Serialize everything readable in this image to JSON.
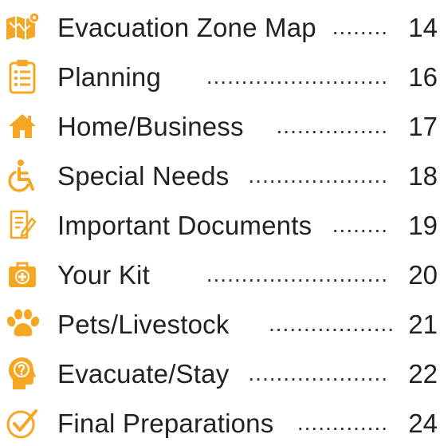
{
  "toc": {
    "accent_color": "#f5a623",
    "entries": [
      {
        "label": "Evacuation Zone Map",
        "page": "14",
        "icon": "map-icon"
      },
      {
        "label": "Planning",
        "page": "16",
        "icon": "clipboard-icon"
      },
      {
        "label": "Home/Business",
        "page": "17",
        "icon": "house-icon"
      },
      {
        "label": "Special Needs",
        "page": "18",
        "icon": "wheelchair-icon"
      },
      {
        "label": "Important Documents",
        "page": "19",
        "icon": "document-icon"
      },
      {
        "label": "Your Kit",
        "page": "20",
        "icon": "first-aid-kit-icon"
      },
      {
        "label": "Pets/Livestock",
        "page": "21",
        "icon": "paw-icon"
      },
      {
        "label": "Evacuate/Stay",
        "page": "22",
        "icon": "head-question-icon"
      },
      {
        "label": "Final Preparations",
        "page": "24",
        "icon": "checkmark-icon"
      }
    ]
  }
}
